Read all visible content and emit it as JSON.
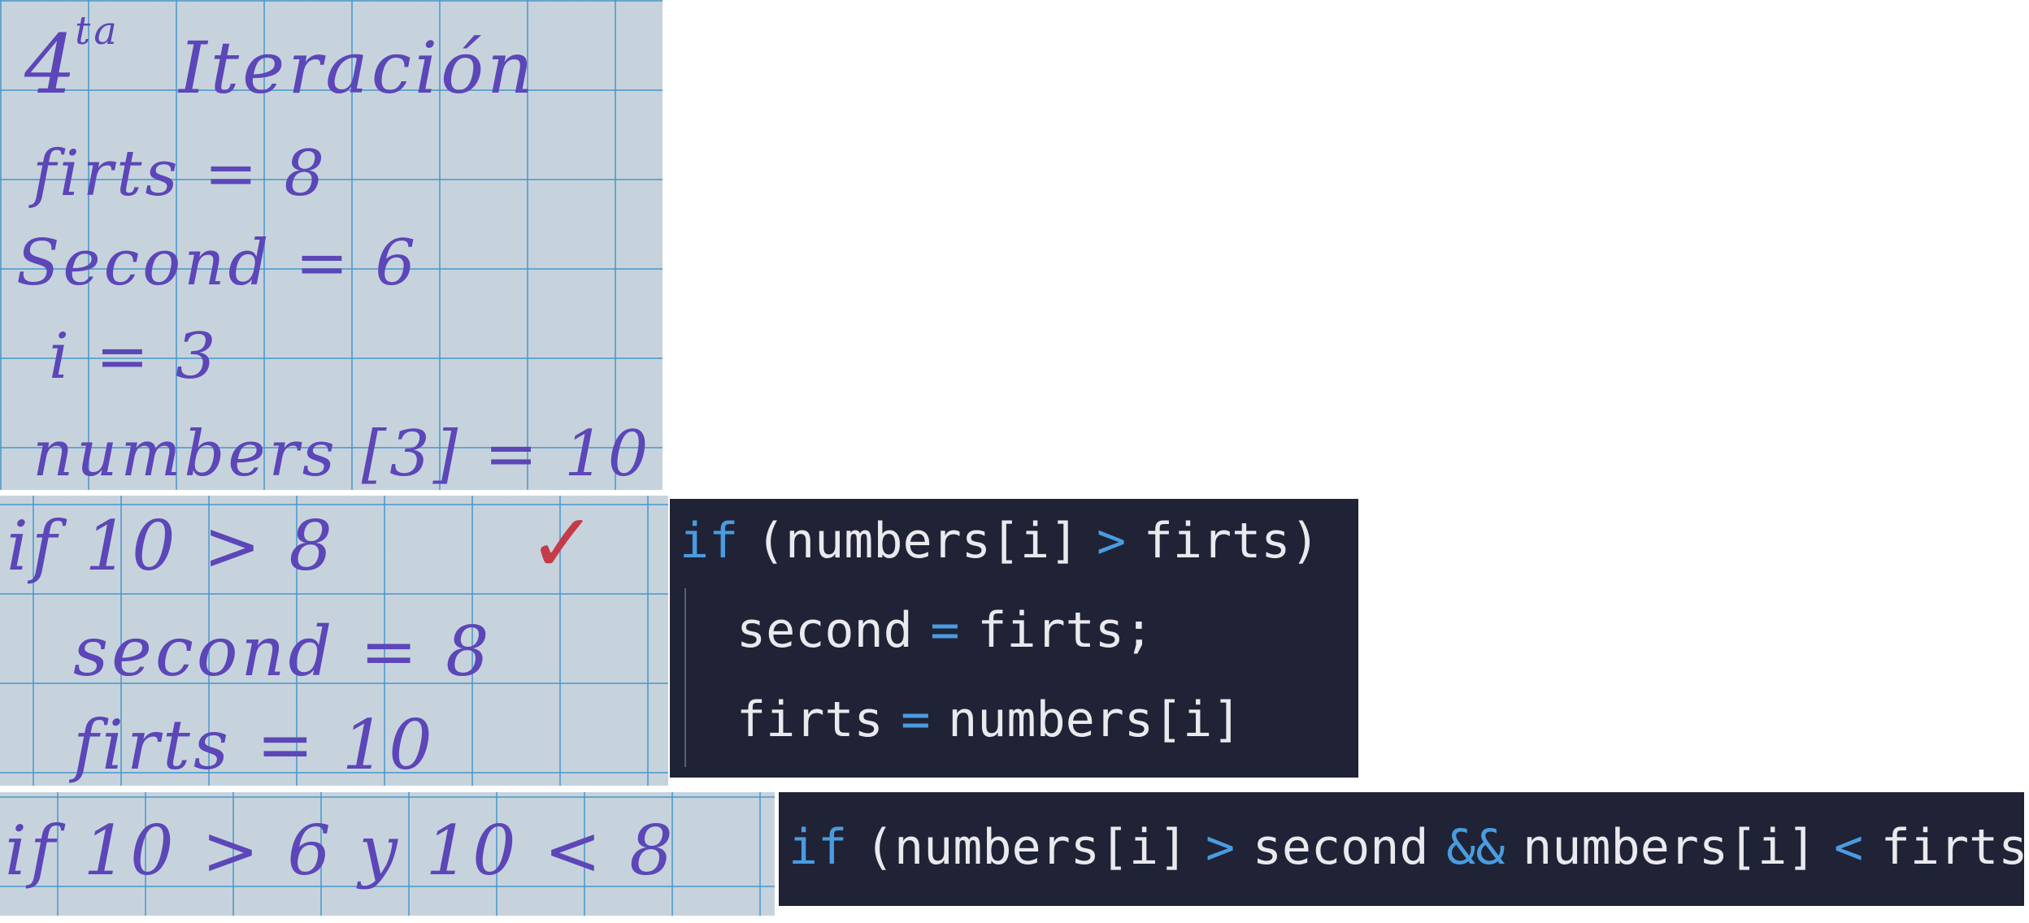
{
  "notebook": {
    "header_num": "4",
    "header_sup": "ta",
    "header_word": "Iteración",
    "lines1": [
      "firts = 8",
      "Second = 6",
      "i = 3",
      "numbers [3] = 10"
    ],
    "if1": "if  10  > 8",
    "check": "✓",
    "lines2": [
      "second = 8",
      "firts = 10"
    ],
    "if2": "if  10 > 6  y  10 < 8"
  },
  "code1": {
    "kw_if": "if",
    "open": "(numbers[i]",
    "gt": ">",
    "close": "firts)",
    "l2_a": "second",
    "eq": "=",
    "l2_b": "firts;",
    "l3_a": "firts",
    "l3_b": "numbers[i]"
  },
  "code2": {
    "kw_if": "if",
    "a": "(numbers[i]",
    "gt": ">",
    "b": "second",
    "and": "&&",
    "c": "numbers[i]",
    "lt": "<",
    "d": "firts)"
  },
  "colors": {
    "ink": "#5c46b8",
    "grid": "#4696cd",
    "paper": "#c7d3dc",
    "code_bg": "#1f2335",
    "keyword": "#4a9be0",
    "check": "#c43b4a"
  }
}
